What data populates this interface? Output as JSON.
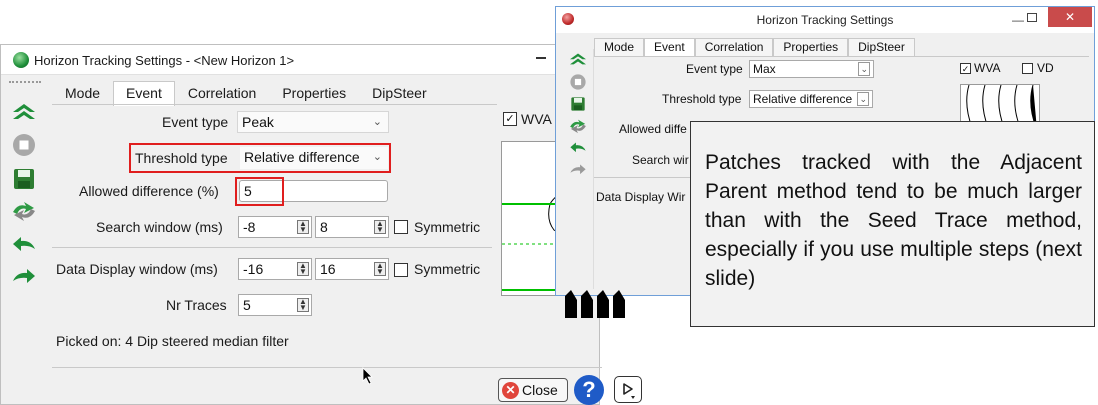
{
  "main_window": {
    "title": "Horizon Tracking Settings - <New Horizon 1>",
    "tabs": [
      "Mode",
      "Event",
      "Correlation",
      "Properties",
      "DipSteer"
    ],
    "active_tab": "Event",
    "event_type": {
      "label": "Event type",
      "value": "Peak"
    },
    "threshold_type": {
      "label": "Threshold type",
      "value": "Relative difference"
    },
    "allowed_difference": {
      "label": "Allowed difference (%)",
      "value": "5"
    },
    "search_window": {
      "label": "Search window (ms)",
      "min": "-8",
      "max": "8",
      "symmetric_label": "Symmetric",
      "symmetric_checked": false
    },
    "data_display_window": {
      "label": "Data Display window (ms)",
      "min": "-16",
      "max": "16",
      "symmetric_label": "Symmetric",
      "symmetric_checked": false
    },
    "nr_traces": {
      "label": "Nr Traces",
      "value": "5"
    },
    "picked_on": "Picked on: 4 Dip steered median filter",
    "wva_label": "WVA",
    "wva_checked": true,
    "close_label": "Close",
    "help_label": "?"
  },
  "small_window": {
    "title": "Horizon Tracking Settings",
    "tabs": [
      "Mode",
      "Event",
      "Correlation",
      "Properties",
      "DipSteer"
    ],
    "active_tab": "Event",
    "event_type": {
      "label": "Event type",
      "value": "Max"
    },
    "threshold_type": {
      "label": "Threshold type",
      "value": "Relative difference"
    },
    "allowed_diff_label": "Allowed diffe",
    "search_win_label": "Search wir",
    "data_display_label": "Data Display Wir",
    "wva_label": "WVA",
    "wva_checked": true,
    "vd_label": "VD",
    "vd_checked": false
  },
  "callout": {
    "text": "Patches tracked with the Adjacent Parent method tend to be much larger than with the Seed Trace method, especially if you use multiple steps (next slide)"
  },
  "colors": {
    "highlight_red": "#e01e1e",
    "toolbar_green": "#1f8f3a",
    "help_blue": "#1f5bc7",
    "close_red": "#e0453b",
    "preview_green": "#00c000"
  },
  "icons": [
    "track-icon",
    "stop-icon",
    "save-icon",
    "retrack-icon",
    "undo-icon",
    "redo-icon"
  ]
}
